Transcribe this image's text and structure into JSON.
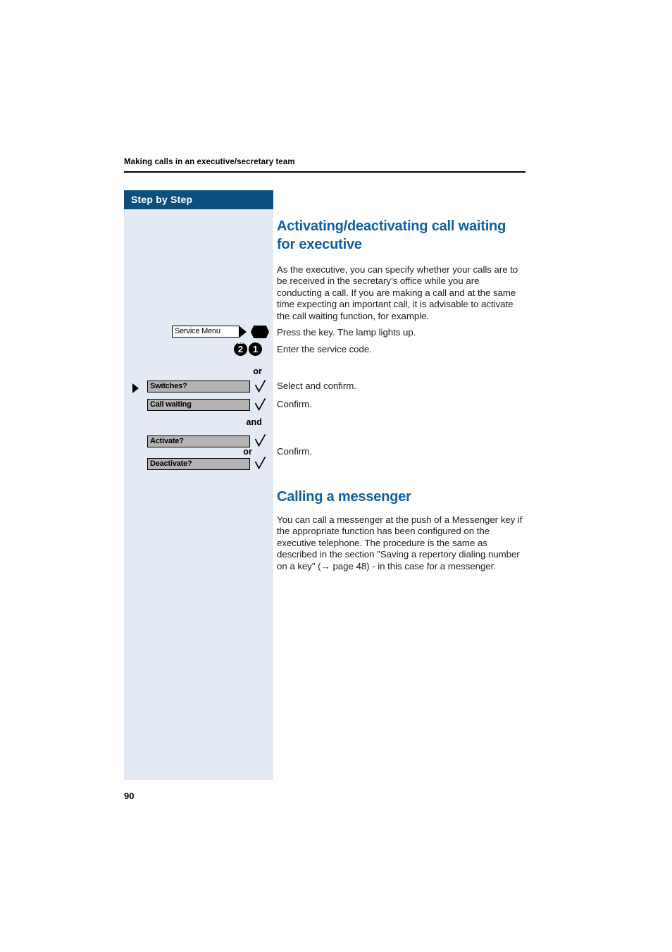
{
  "page": {
    "running_header": "Making calls in an executive/secretary team",
    "folio": "90",
    "accent_heading_color": "#1060a0",
    "sidebar_header_color": "#0b4f7f",
    "sidebar_bg_color": "#e3eaf3"
  },
  "sidebar": {
    "title": "Step by Step",
    "steps": [
      {
        "type": "softkey-white",
        "label": "Service Menu",
        "icon": "service-menu-key-icon",
        "lamp_icon": "lamp-key-icon",
        "instruction": "Press the key. The lamp lights up."
      },
      {
        "type": "dialpad",
        "keys": [
          {
            "digit": "2",
            "letters": "abc"
          },
          {
            "digit": "1",
            "letters": ""
          }
        ],
        "instruction": "Enter the service code."
      },
      {
        "type": "connector",
        "label": "or"
      },
      {
        "type": "display-option",
        "label": "Switches?",
        "selected": true,
        "marker_icon": "selection-arrow-icon",
        "confirm_icon": "checkmark-icon",
        "instruction": "Select and confirm."
      },
      {
        "type": "display-option",
        "label": "Call waiting",
        "selected": false,
        "confirm_icon": "checkmark-icon",
        "instruction": "Confirm."
      },
      {
        "type": "connector",
        "label": "and"
      },
      {
        "type": "display-option",
        "label": "Activate?",
        "selected": false,
        "confirm_icon": "checkmark-icon",
        "instruction": ""
      },
      {
        "type": "connector",
        "label": "or"
      },
      {
        "type": "display-option",
        "label": "Deactivate?",
        "selected": false,
        "confirm_icon": "checkmark-icon",
        "instruction": "Confirm."
      }
    ],
    "instructions": {
      "press_key": "Press the key. The lamp lights up.",
      "enter_code": "Enter the service code.",
      "select_confirm": "Select and confirm.",
      "confirm_1": "Confirm.",
      "confirm_2": "Confirm."
    },
    "connectors": {
      "or_1": "or",
      "and_1": "and",
      "or_2": "or"
    }
  },
  "content": {
    "section_1": {
      "title_line_1": "Activating/deactivating call waiting",
      "title_line_2": "for executive",
      "body": "As the executive, you can specify whether your calls are to be received in the secretary’s office while you are conducting a call. If you are making a call and at the same time expecting an important call, it is advisable to activate the call waiting function, for example."
    },
    "section_2": {
      "title": "Calling a messenger",
      "body": "You can call a messenger at the push of a Messenger key if the appropriate function has been configured on the executive telephone. The procedure is the same as described in the section \"Saving a repertory dialing number on a key\" (→ page 48) - in this case for a messenger."
    }
  }
}
